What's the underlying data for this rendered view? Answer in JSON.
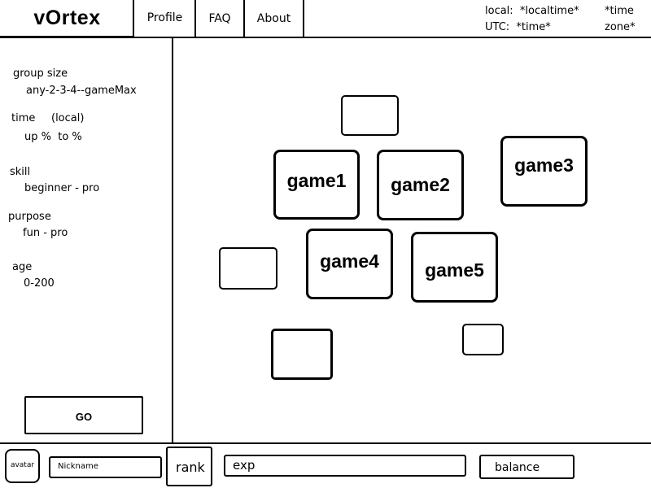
{
  "header": {
    "logo": "vOrtex",
    "nav": [
      {
        "label": "Profile"
      },
      {
        "label": "FAQ"
      },
      {
        "label": "About"
      }
    ],
    "clock": {
      "local_line": "local:  *localtime*",
      "utc_line": "UTC:  *time*",
      "timezone_line1": "*time",
      "timezone_line2": "zone*"
    }
  },
  "filters": {
    "group_size": {
      "label": "group size",
      "value": "any-2-3-4--gameMax"
    },
    "time": {
      "label": "time",
      "sublabel": "(local)",
      "value": "up %  to %"
    },
    "skill": {
      "label": "skill",
      "value": "beginner - pro"
    },
    "purpose": {
      "label": "purpose",
      "value": "fun - pro"
    },
    "age": {
      "label": "age",
      "value": "0-200"
    },
    "go_label": "GO"
  },
  "games": [
    {
      "label": "game1"
    },
    {
      "label": "game2"
    },
    {
      "label": "game3"
    },
    {
      "label": "game4"
    },
    {
      "label": "game5"
    }
  ],
  "footer": {
    "avatar_label": "avatar",
    "nickname": "Nickname",
    "rank": "rank",
    "exp": "exp",
    "balance": "balance"
  }
}
